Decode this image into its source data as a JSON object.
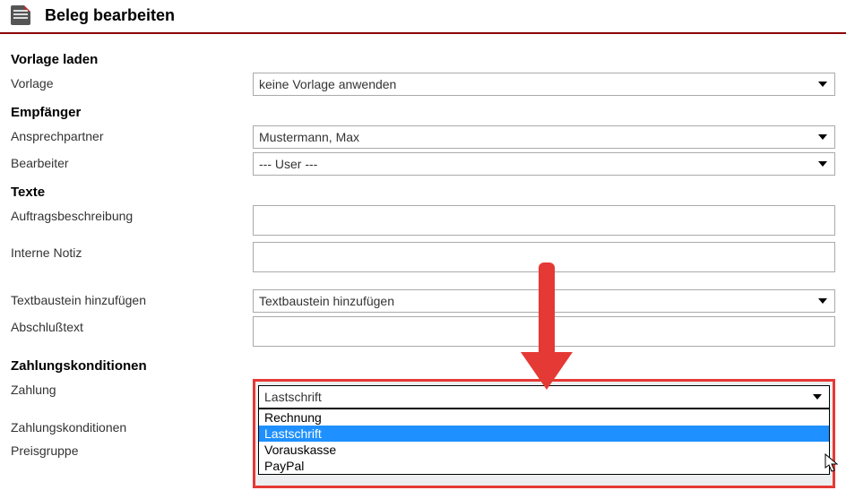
{
  "header": {
    "title": "Beleg bearbeiten"
  },
  "sections": {
    "vorlage_laden": {
      "title": "Vorlage laden",
      "vorlage_label": "Vorlage",
      "vorlage_value": "keine Vorlage anwenden"
    },
    "empfaenger": {
      "title": "Empfänger",
      "ansprechpartner_label": "Ansprechpartner",
      "ansprechpartner_value": "Mustermann, Max",
      "bearbeiter_label": "Bearbeiter",
      "bearbeiter_value": "--- User ---"
    },
    "texte": {
      "title": "Texte",
      "auftragsbeschreibung_label": "Auftragsbeschreibung",
      "auftragsbeschreibung_value": "",
      "interne_notiz_label": "Interne Notiz",
      "interne_notiz_value": "",
      "textbaustein_label": "Textbaustein hinzufügen",
      "textbaustein_value": "Textbaustein hinzufügen",
      "abschlusstext_label": "Abschlußtext",
      "abschlusstext_value": ""
    },
    "zahlung": {
      "title": "Zahlungskonditionen",
      "zahlung_label": "Zahlung",
      "zahlung_value": "Lastschrift",
      "zahlung_options": [
        "Rechnung",
        "Lastschrift",
        "Vorauskasse",
        "PayPal"
      ],
      "konditionen_label": "Zahlungskonditionen",
      "preisgruppe_label": "Preisgruppe"
    }
  }
}
